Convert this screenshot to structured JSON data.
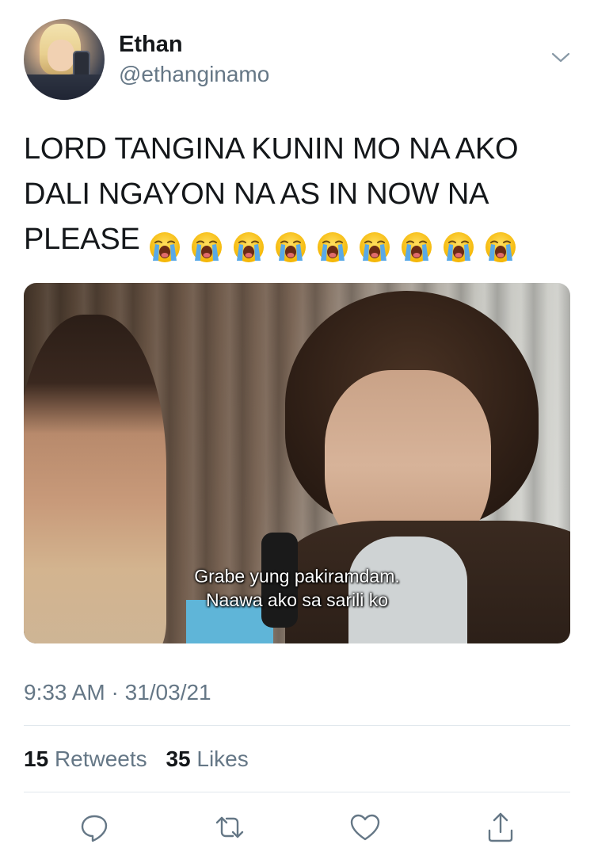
{
  "user": {
    "name": "Ethan",
    "handle": "@ethanginamo"
  },
  "tweet": {
    "line1": "LORD TANGINA KUNIN MO NA AKO",
    "line2": "DALI NGAYON NA AS IN NOW NA",
    "line3": "PLEASE",
    "emoji_name": "loudly-crying-face-emoji",
    "emoji_count": 9
  },
  "media": {
    "caption_line1": "Grabe yung pakiramdam.",
    "caption_line2": "Naawa ako sa sarili ko"
  },
  "meta": {
    "time": "9:33 AM",
    "separator": "·",
    "date": "31/03/21"
  },
  "stats": {
    "retweets_count": "15",
    "retweets_label": "Retweets",
    "likes_count": "35",
    "likes_label": "Likes"
  },
  "colors": {
    "primary_text": "#14171a",
    "secondary_text": "#657786",
    "divider": "#e1e8ed"
  }
}
